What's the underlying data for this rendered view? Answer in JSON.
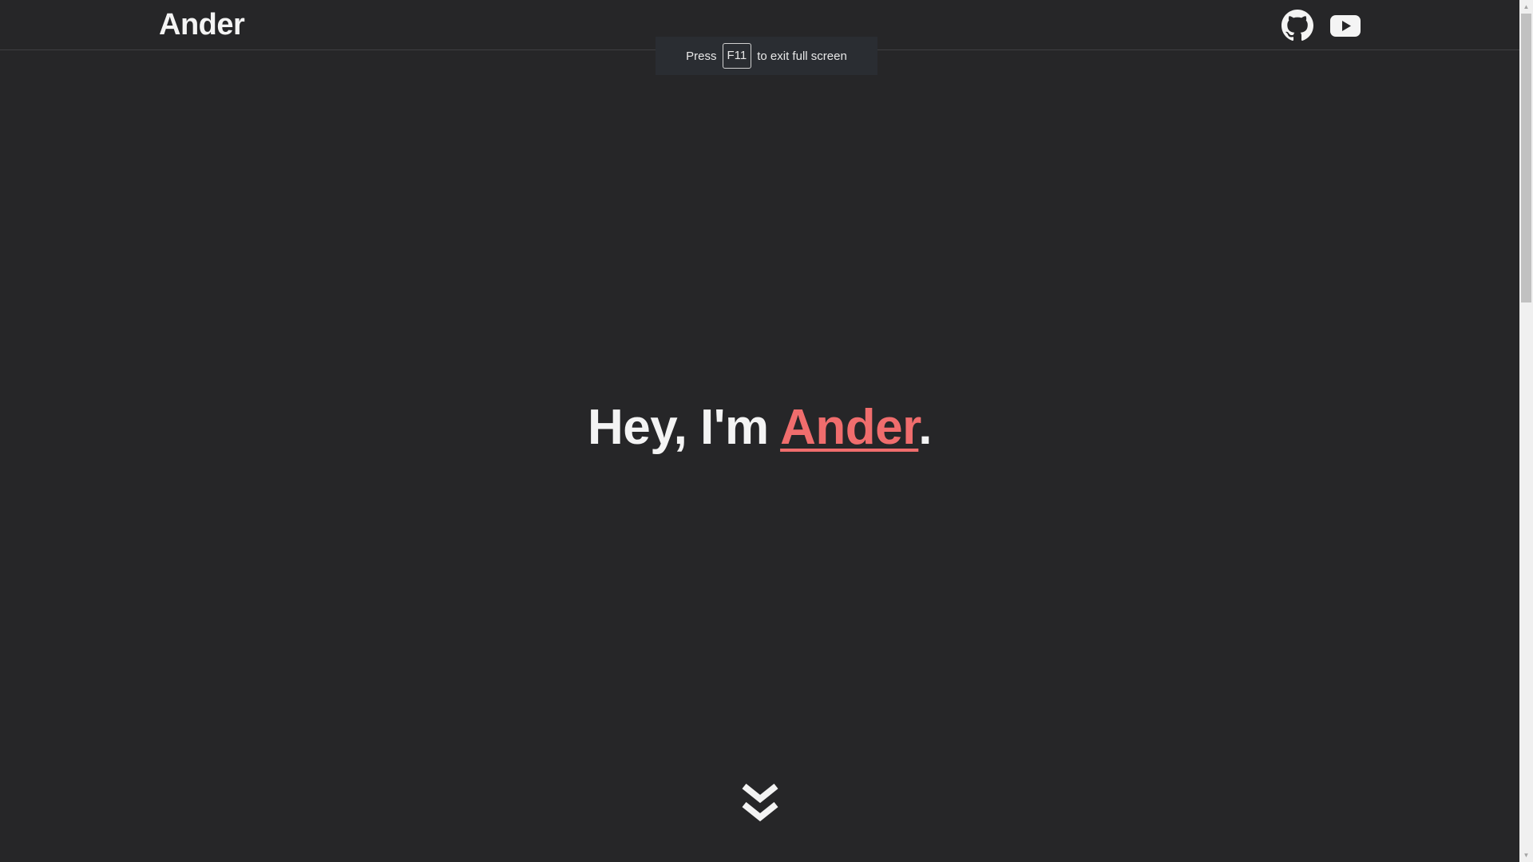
{
  "header": {
    "brand": "Ander",
    "social": [
      {
        "name": "github",
        "icon": "github-icon"
      },
      {
        "name": "youtube",
        "icon": "youtube-icon"
      }
    ]
  },
  "fullscreen_notice": {
    "before": "Press",
    "key": "F11",
    "after": "to exit full screen"
  },
  "hero": {
    "greeting": "Hey, I'm ",
    "name": "Ander",
    "punctuation": "."
  },
  "scroll_hint": {
    "icon": "double-chevron-down-icon"
  },
  "colors": {
    "background": "#262628",
    "accent": "#f06d6d",
    "text": "#f4f4f4"
  }
}
